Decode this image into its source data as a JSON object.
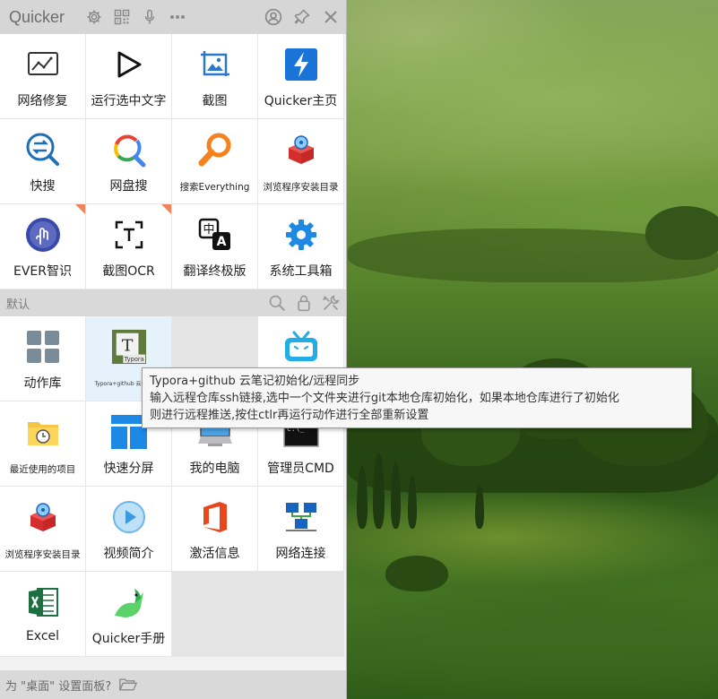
{
  "app": {
    "title": "Quicker",
    "titlebar_icons": [
      "gear-icon",
      "qr-code-icon",
      "microphone-icon",
      "more-icon"
    ],
    "titlebar_right_icons": [
      "user-icon",
      "pin-icon",
      "close-icon"
    ]
  },
  "pinned_actions": [
    {
      "label": "网络修复",
      "icon": "network-repair-icon"
    },
    {
      "label": "运行选中文字",
      "icon": "play-triangle-icon"
    },
    {
      "label": "截图",
      "icon": "screenshot-icon"
    },
    {
      "label": "Quicker主页",
      "icon": "quicker-bolt-icon"
    },
    {
      "label": "快搜",
      "icon": "quick-search-icon"
    },
    {
      "label": "网盘搜",
      "icon": "google-search-icon"
    },
    {
      "label": "搜索Everything",
      "icon": "everything-search-icon"
    },
    {
      "label": "浏览程序安装目录",
      "icon": "install-dir-icon"
    },
    {
      "label": "EVER智识",
      "icon": "ever-fingerprint-icon"
    },
    {
      "label": "截图OCR",
      "icon": "ocr-icon"
    },
    {
      "label": "翻译终极版",
      "icon": "translate-icon"
    },
    {
      "label": "系统工具箱",
      "icon": "settings-gear-icon"
    }
  ],
  "section": {
    "label": "默认"
  },
  "default_actions": [
    {
      "label": "动作库",
      "icon": "action-library-icon"
    },
    {
      "label": "Typora+github 云笔记初始",
      "icon": "typora-icon"
    },
    {
      "label": "",
      "icon": ""
    },
    {
      "label": "",
      "icon": "bilibili-icon"
    },
    {
      "label": "最近使用的项目",
      "icon": "recent-folder-icon"
    },
    {
      "label": "快速分屏",
      "icon": "split-screen-icon"
    },
    {
      "label": "我的电脑",
      "icon": "computer-icon"
    },
    {
      "label": "管理员CMD",
      "icon": "cmd-icon"
    },
    {
      "label": "浏览程序安装目录",
      "icon": "install-dir-icon"
    },
    {
      "label": "视频简介",
      "icon": "video-play-icon"
    },
    {
      "label": "激活信息",
      "icon": "office-icon"
    },
    {
      "label": "网络连接",
      "icon": "network-connection-icon"
    },
    {
      "label": "Excel",
      "icon": "excel-icon"
    },
    {
      "label": "Quicker手册",
      "icon": "bird-icon"
    }
  ],
  "tooltip": {
    "title": "Typora+github 云笔记初始化/远程同步",
    "line1": "输入远程仓库ssh链接,选中一个文件夹进行git本地仓库初始化，如果本地仓库进行了初始化",
    "line2": "则进行远程推送,按住ctlr再运行动作进行全部重新设置"
  },
  "footer": {
    "text": "为 \"桌面\" 设置面板?"
  },
  "colors": {
    "accent_blue": "#1a73d6",
    "corner_marker": "#f0845b",
    "orange": "#f5821f"
  }
}
